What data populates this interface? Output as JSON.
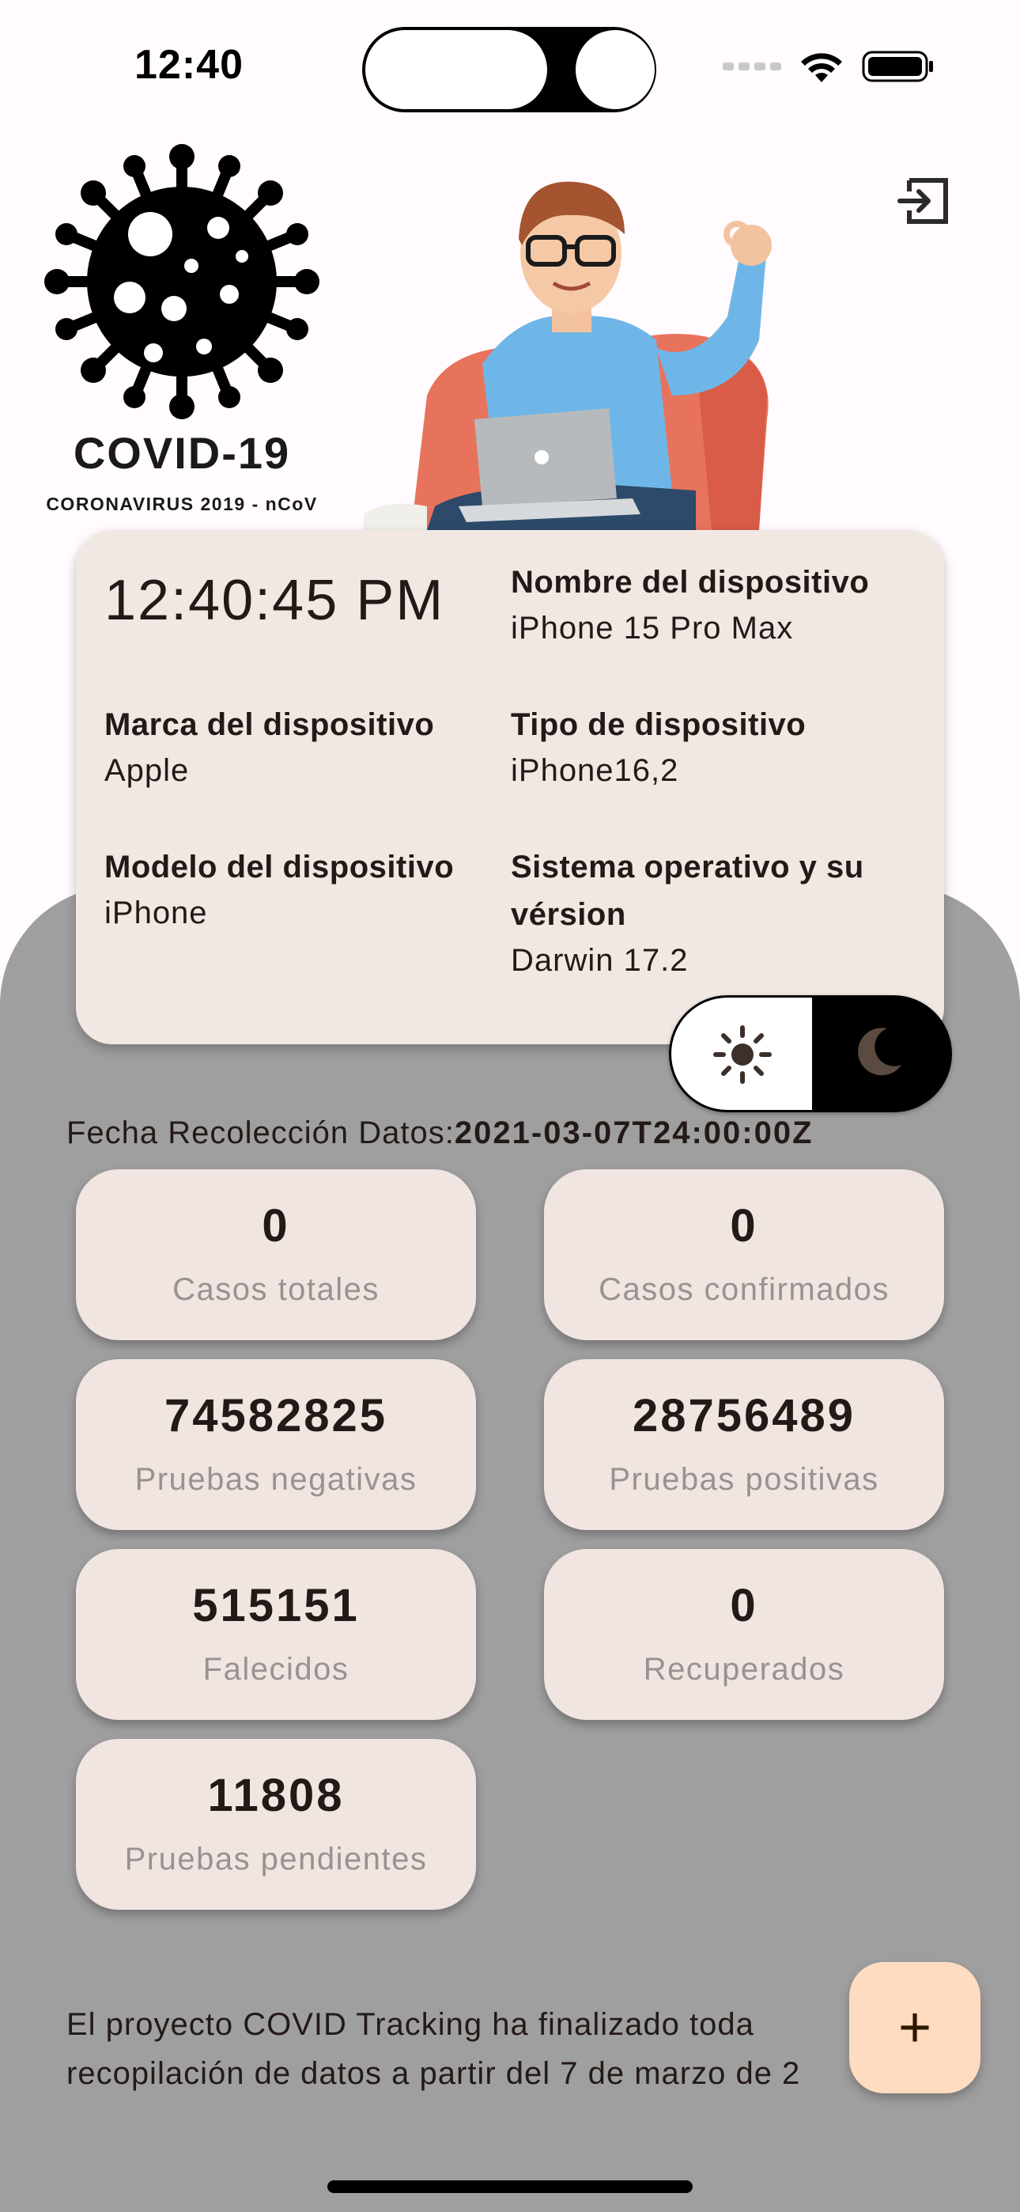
{
  "status_bar": {
    "time": "12:40"
  },
  "header": {
    "logo_title": "COVID-19",
    "logo_subtitle": "CORONAVIRUS 2019 - nCoV",
    "logout_icon": "logout-icon"
  },
  "device_card": {
    "clock": "12:40:45 PM",
    "device_name_label": "Nombre del dispositivo",
    "device_name_value": "iPhone 15 Pro Max",
    "brand_label": "Marca del dispositivo",
    "brand_value": "Apple",
    "type_label": "Tipo de dispositivo",
    "type_value": "iPhone16,2",
    "model_label": "Modelo del dispositivo",
    "model_value": "iPhone",
    "os_label_line1": "Sistema operativo y su",
    "os_label_line2": "vérsion",
    "os_value": "Darwin 17.2"
  },
  "theme_switch": {
    "light_icon": "sun-icon",
    "dark_icon": "moon-icon"
  },
  "collection": {
    "label": "Fecha Recolección Datos:",
    "date": "2021-03-07T24:00:00Z"
  },
  "stats": [
    {
      "value": "0",
      "label": "Casos totales"
    },
    {
      "value": "0",
      "label": "Casos confirmados"
    },
    {
      "value": "74582825",
      "label": "Pruebas negativas"
    },
    {
      "value": "28756489",
      "label": "Pruebas positivas"
    },
    {
      "value": "515151",
      "label": "Falecidos"
    },
    {
      "value": "0",
      "label": "Recuperados"
    },
    {
      "value": "11808",
      "label": "Pruebas pendientes"
    }
  ],
  "footer": {
    "line1": "El proyecto COVID Tracking ha finalizado toda",
    "line2": "recopilación de datos a partir del 7 de marzo de 2"
  },
  "fab": {
    "label": "+"
  },
  "colors": {
    "card": "#f1e8e4",
    "panel": "#a09fa0",
    "fab": "#ffdcc0",
    "text": "#231a17",
    "muted": "#9a9190"
  }
}
